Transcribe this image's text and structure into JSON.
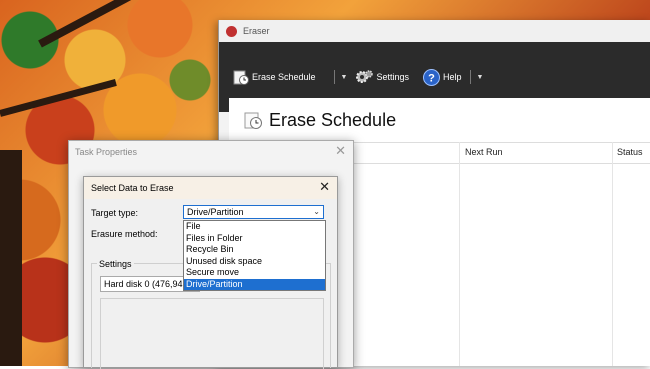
{
  "main_window": {
    "title": "Eraser",
    "toolbar": {
      "erase_schedule": "Erase Schedule",
      "settings": "Settings",
      "help": "Help"
    },
    "page_title": "Erase Schedule",
    "columns": [
      "Next Run",
      "Status"
    ]
  },
  "task_properties": {
    "title": "Task Properties"
  },
  "select_data": {
    "title": "Select Data to Erase",
    "target_type_label": "Target type:",
    "target_type_value": "Drive/Partition",
    "erasure_method_label": "Erasure method:",
    "options": [
      "File",
      "Files in Folder",
      "Recycle Bin",
      "Unused disk space",
      "Secure move",
      "Drive/Partition"
    ],
    "selected_option": "Drive/Partition",
    "settings_label": "Settings",
    "disk_value": "Hard disk 0 (476,94"
  },
  "colors": {
    "accent": "#1e6fd0",
    "toolbar_bg": "#2b2b2b"
  }
}
